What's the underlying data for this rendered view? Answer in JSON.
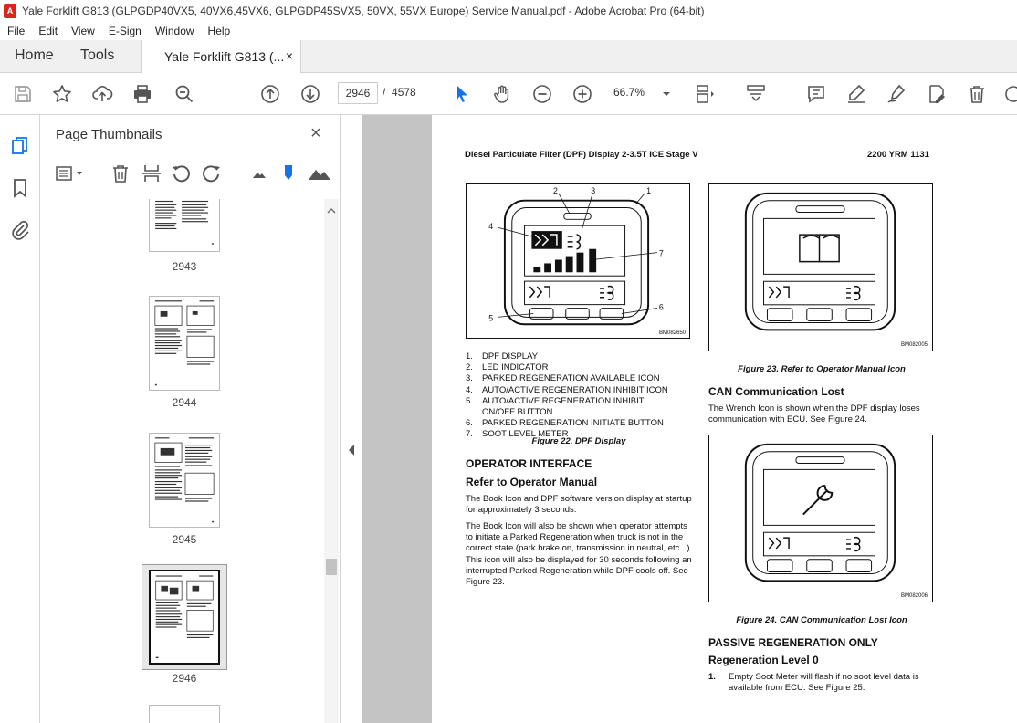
{
  "window": {
    "title": "Yale Forklift G813 (GLPGDP40VX5, 40VX6,45VX6, GLPGDP45SVX5, 50VX, 55VX Europe) Service Manual.pdf - Adobe Acrobat Pro (64-bit)"
  },
  "menu": [
    "File",
    "Edit",
    "View",
    "E-Sign",
    "Window",
    "Help"
  ],
  "tabs": {
    "home": "Home",
    "tools": "Tools",
    "document": "Yale Forklift G813 (...",
    "close": "×"
  },
  "toolbar": {
    "current_page": "2946",
    "page_separator": "/",
    "total_pages": "4578",
    "zoom": "66.7%"
  },
  "thumbnails": {
    "title": "Page Thumbnails",
    "close": "×",
    "pages": [
      {
        "label": "2943"
      },
      {
        "label": "2944"
      },
      {
        "label": "2945"
      },
      {
        "label": "2946",
        "selected": true
      }
    ]
  },
  "page": {
    "header_left": "Diesel Particulate Filter (DPF) Display 2-3.5T ICE Stage V",
    "header_right": "2200 YRM 1131",
    "fig22": {
      "callouts": [
        "1",
        "2",
        "3",
        "4",
        "5",
        "6",
        "7"
      ],
      "code": "BM082650",
      "caption": "Figure 22. DPF Display"
    },
    "legend": [
      {
        "n": "1.",
        "text": "DPF DISPLAY"
      },
      {
        "n": "2.",
        "text": "LED INDICATOR"
      },
      {
        "n": "3.",
        "text": "PARKED REGENERATION AVAILABLE ICON"
      },
      {
        "n": "4.",
        "text": "AUTO/ACTIVE REGENERATION INHIBIT ICON"
      },
      {
        "n": "5.",
        "text": "AUTO/ACTIVE REGENERATION INHIBIT"
      },
      {
        "n": "",
        "text": "ON/OFF BUTTON"
      },
      {
        "n": "6.",
        "text": "PARKED REGENERATION INITIATE BUTTON"
      },
      {
        "n": "7.",
        "text": "SOOT LEVEL METER"
      }
    ],
    "operator_interface": "OPERATOR INTERFACE",
    "refer_heading": "Refer to Operator Manual",
    "para1": "The Book Icon and DPF software version display at startup for approximately 3 seconds.",
    "para2": "The Book Icon will also be shown when operator attempts to initiate a Parked Regeneration when truck is not in the correct state (park brake on, transmission in neutral, etc...). This icon will also be displayed for 30 seconds following an interrupted Parked Regeneration while DPF cools off. See Figure 23.",
    "fig23": {
      "code": "BM082005",
      "caption": "Figure 23. Refer to Operator Manual Icon"
    },
    "can_heading": "CAN Communication Lost",
    "can_para": "The Wrench Icon is shown when the DPF display loses communication with ECU. See Figure 24.",
    "fig24": {
      "code": "BM082006",
      "caption": "Figure 24. CAN Communication Lost Icon"
    },
    "passive_heading": "PASSIVE REGENERATION ONLY",
    "regen0_heading": "Regeneration Level 0",
    "regen0_item_n": "1.",
    "regen0_item": "Empty Soot Meter will flash if no soot level data is available from ECU. See Figure 25."
  },
  "icons": {
    "toolbar": [
      "save-icon",
      "star-icon",
      "upload-icon",
      "print-icon",
      "zoom-search-icon",
      "prev-page-icon",
      "next-page-icon",
      "select-cursor-icon",
      "hand-icon",
      "zoom-out-icon",
      "zoom-in-icon",
      "fit-page-icon",
      "scroll-mode-icon",
      "comment-icon",
      "highlight-icon",
      "sign-icon",
      "edit-icon",
      "delete-icon"
    ],
    "leftrail": [
      "thumbnails-icon",
      "bookmark-icon",
      "attachment-icon"
    ]
  },
  "colors": {
    "accent_blue": "#1473e6",
    "app_red": "#d7261e",
    "doc_background": "#c4c4c4"
  }
}
